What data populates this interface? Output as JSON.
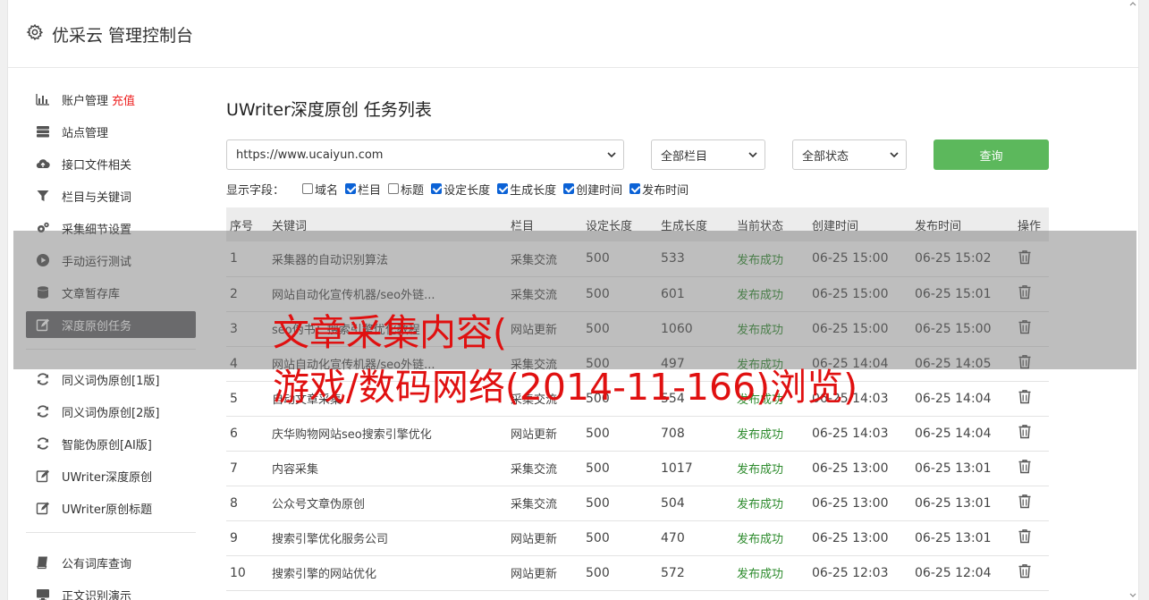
{
  "app": {
    "title": "优采云 管理控制台"
  },
  "sidebar": {
    "group1": [
      {
        "label": "账户管理",
        "badge": "充值",
        "icon": "bar-chart-icon"
      },
      {
        "label": "站点管理",
        "icon": "server-icon"
      },
      {
        "label": "接口文件相关",
        "icon": "cloud-upload-icon"
      },
      {
        "label": "栏目与关键词",
        "icon": "filter-icon"
      },
      {
        "label": "采集细节设置",
        "icon": "gears-icon"
      },
      {
        "label": "手动运行测试",
        "icon": "play-icon"
      },
      {
        "label": "文章暂存库",
        "icon": "database-icon"
      },
      {
        "label": "深度原创任务",
        "icon": "edit-icon",
        "active": true
      }
    ],
    "group2": [
      {
        "label": "同义词伪原创[1版]",
        "icon": "refresh-icon"
      },
      {
        "label": "同义词伪原创[2版]",
        "icon": "refresh-icon"
      },
      {
        "label": "智能伪原创[AI版]",
        "icon": "refresh-icon"
      },
      {
        "label": "UWriter深度原创",
        "icon": "edit-icon"
      },
      {
        "label": "UWriter原创标题",
        "icon": "edit-icon"
      }
    ],
    "group3": [
      {
        "label": "公有词库查询",
        "icon": "book-icon"
      },
      {
        "label": "正文识别演示",
        "icon": "monitor-icon"
      }
    ]
  },
  "main": {
    "title": "UWriter深度原创 任务列表",
    "site_select": "https://www.ucaiyun.com",
    "column_select": "全部栏目",
    "status_select": "全部状态",
    "query_button": "查询",
    "fields_label": "显示字段：",
    "fields": [
      {
        "label": "域名",
        "checked": false
      },
      {
        "label": "栏目",
        "checked": true
      },
      {
        "label": "标题",
        "checked": false
      },
      {
        "label": "设定长度",
        "checked": true
      },
      {
        "label": "生成长度",
        "checked": true
      },
      {
        "label": "创建时间",
        "checked": true
      },
      {
        "label": "发布时间",
        "checked": true
      }
    ],
    "table": {
      "headers": [
        "序号",
        "关键词",
        "栏目",
        "设定长度",
        "生成长度",
        "当前状态",
        "创建时间",
        "发布时间",
        "操作"
      ],
      "rows": [
        [
          "1",
          "采集器的自动识别算法",
          "采集交流",
          "500",
          "533",
          "发布成功",
          "06-25 15:00",
          "06-25 15:02"
        ],
        [
          "2",
          "网站自动化宣传机器/seo外链...",
          "采集交流",
          "500",
          "601",
          "发布成功",
          "06-25 15:00",
          "06-25 15:01"
        ],
        [
          "3",
          "seo伪书：搜索引擎优化教程",
          "网站更新",
          "500",
          "1060",
          "发布成功",
          "06-25 15:00",
          "06-25 15:00"
        ],
        [
          "4",
          "网站自动化宣传机器/seo外链...",
          "采集交流",
          "500",
          "497",
          "发布成功",
          "06-25 14:04",
          "06-25 14:05"
        ],
        [
          "5",
          "自动文章采集",
          "采集交流",
          "500",
          "554",
          "发布成功",
          "06-25 14:03",
          "06-25 14:04"
        ],
        [
          "6",
          "庆华购物网站seo搜索引擎优化",
          "网站更新",
          "500",
          "708",
          "发布成功",
          "06-25 14:03",
          "06-25 14:04"
        ],
        [
          "7",
          "内容采集",
          "采集交流",
          "500",
          "1017",
          "发布成功",
          "06-25 13:00",
          "06-25 13:01"
        ],
        [
          "8",
          "公众号文章伪原创",
          "采集交流",
          "500",
          "504",
          "发布成功",
          "06-25 13:00",
          "06-25 13:01"
        ],
        [
          "9",
          "搜索引擎优化服务公司",
          "网站更新",
          "500",
          "470",
          "发布成功",
          "06-25 13:00",
          "06-25 13:01"
        ],
        [
          "10",
          "搜索引擎的网站优化",
          "网站更新",
          "500",
          "572",
          "发布成功",
          "06-25 12:03",
          "06-25 12:04"
        ]
      ]
    }
  },
  "overlay": {
    "line1": "文章采集内容(",
    "line2": "游戏/数码网络(2014-11-166)浏览)"
  }
}
